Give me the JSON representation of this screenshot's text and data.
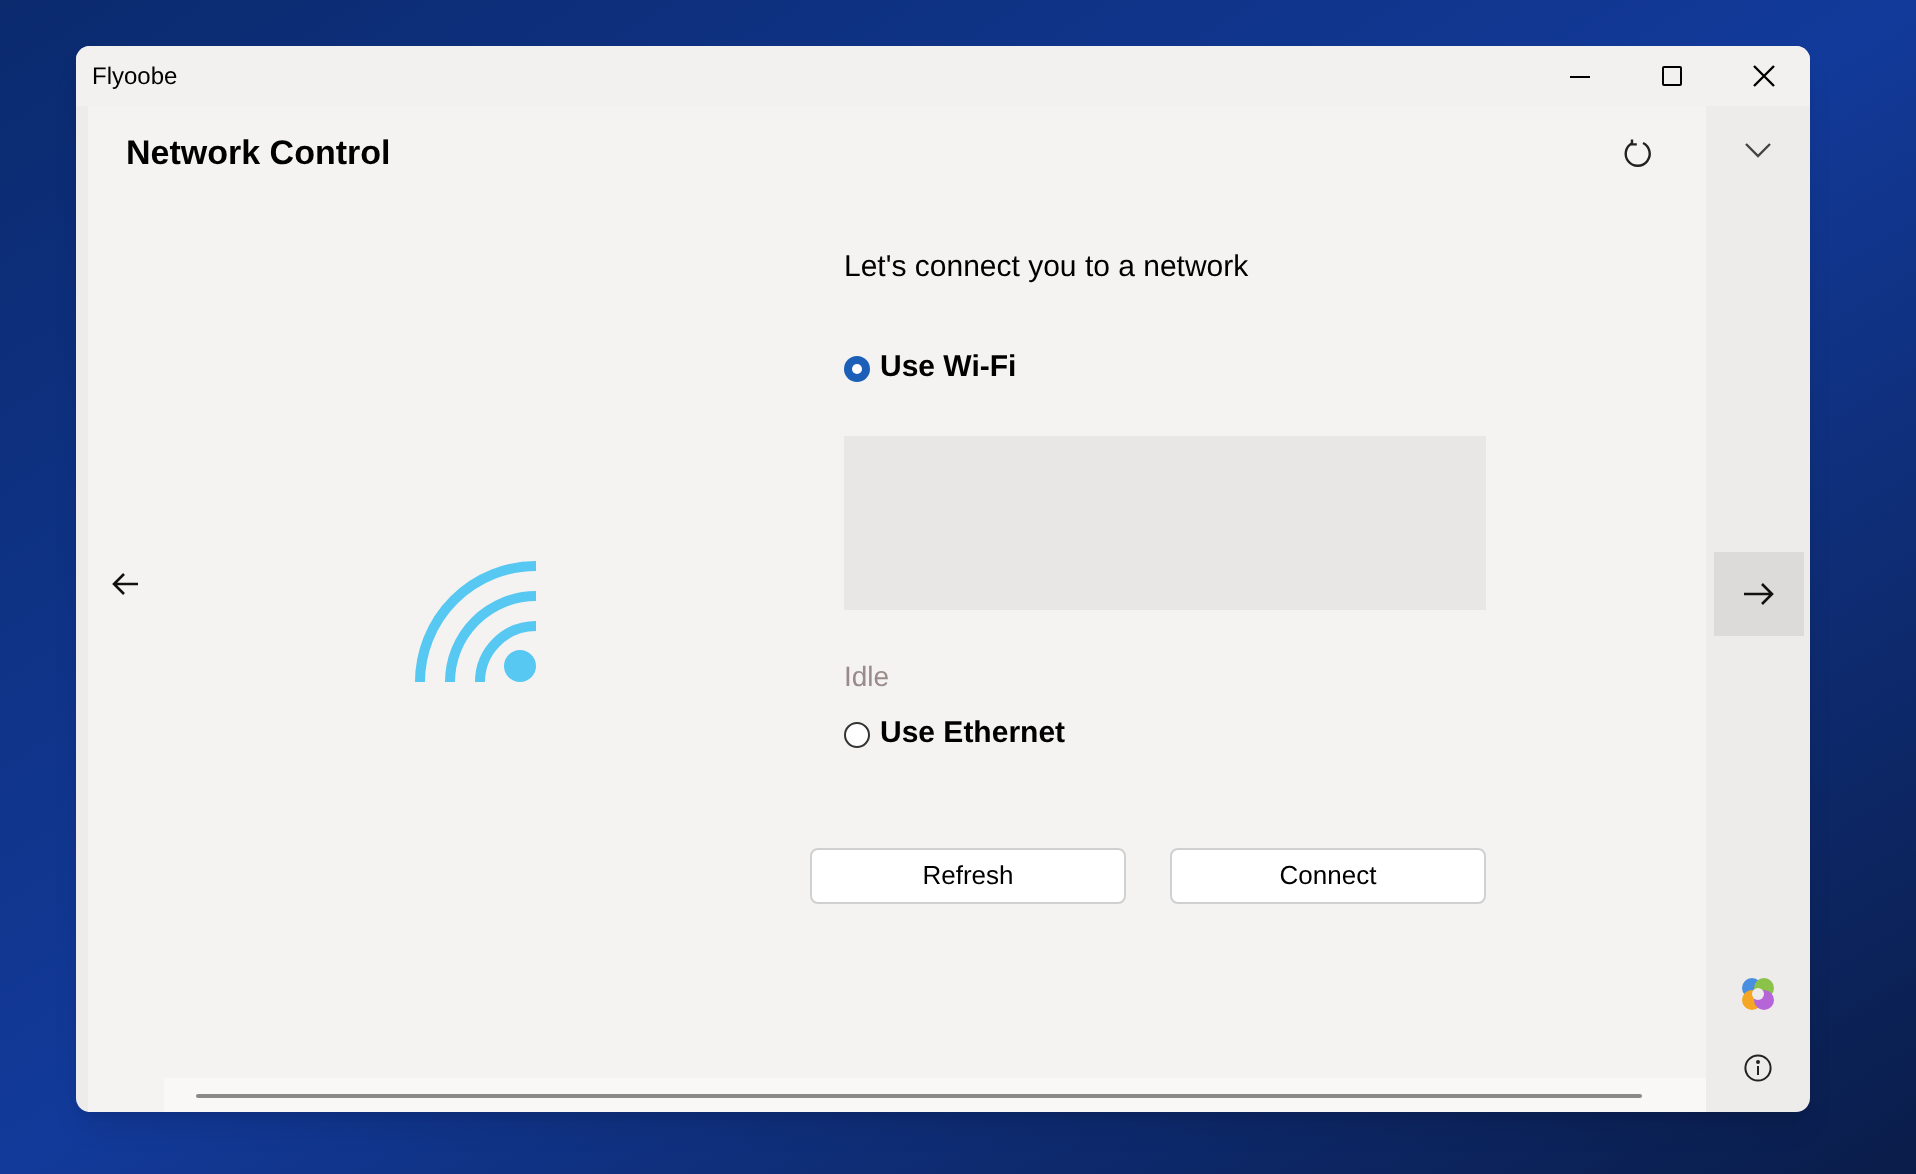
{
  "window": {
    "title": "Flyoobe"
  },
  "page": {
    "title": "Network Control",
    "heading": "Let's connect you to a network"
  },
  "options": [
    {
      "label": "Use Wi-Fi",
      "selected": true
    },
    {
      "label": "Use Ethernet",
      "selected": false
    }
  ],
  "status": "Idle",
  "buttons": [
    "Refresh",
    "Connect"
  ]
}
